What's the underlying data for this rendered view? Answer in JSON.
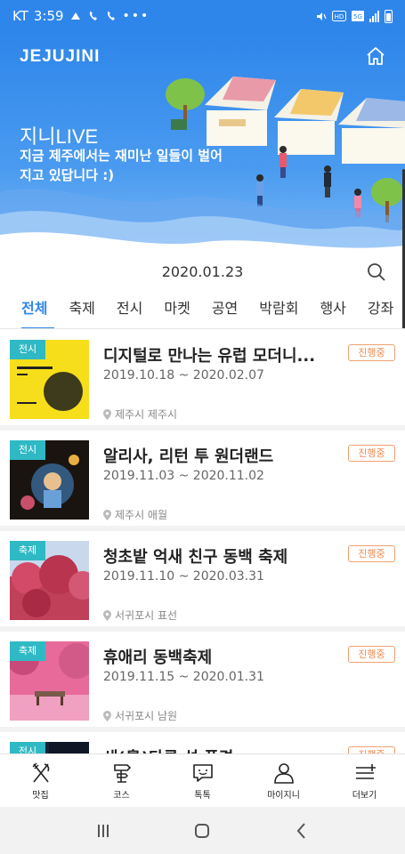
{
  "status_bar": {
    "carrier": "KT",
    "time": "3:59",
    "dots": "•••"
  },
  "header": {
    "logo": "JEJUJINI"
  },
  "banner": {
    "title": "지니LIVE",
    "subtitle": "지금 제주에서는 재미난 일들이 벌어지고 있답니다 :)"
  },
  "date": "2020.01.23",
  "tabs": [
    {
      "label": "전체"
    },
    {
      "label": "축제"
    },
    {
      "label": "전시"
    },
    {
      "label": "마켓"
    },
    {
      "label": "공연"
    },
    {
      "label": "박람회"
    },
    {
      "label": "행사"
    },
    {
      "label": "강좌"
    }
  ],
  "items": [
    {
      "category": "전시",
      "title": "디지털로 만나는 유럽 모더니...",
      "dates": "2019.10.18 ~ 2020.02.07",
      "location": "제주시 제주시",
      "status": "진행중"
    },
    {
      "category": "전시",
      "title": "알리사, 리턴 투 원더랜드",
      "dates": "2019.11.03 ~ 2020.11.02",
      "location": "제주시 애월",
      "status": "진행중"
    },
    {
      "category": "축제",
      "title": "청초밭 억새 친구 동백 축제",
      "dates": "2019.11.10 ~ 2020.03.31",
      "location": "서귀포시 표선",
      "status": "진행중"
    },
    {
      "category": "축제",
      "title": "휴애리 동백축제",
      "dates": "2019.11.15 ~ 2020.01.31",
      "location": "서귀포시 남원",
      "status": "진행중"
    },
    {
      "category": "전시",
      "title": "새(鳥)다른 섬 풍경",
      "dates": "",
      "location": "",
      "status": "진행중"
    }
  ],
  "bottom_nav": [
    {
      "label": "맛집",
      "icon": "fork-knife-icon"
    },
    {
      "label": "코스",
      "icon": "signpost-icon"
    },
    {
      "label": "톡톡",
      "icon": "chat-smile-icon"
    },
    {
      "label": "마이지니",
      "icon": "person-icon"
    },
    {
      "label": "더보기",
      "icon": "menu-plus-icon"
    }
  ],
  "colors": {
    "primary": "#2f86ea",
    "badge_teal": "#2fb9c4",
    "status_orange": "#ec8a4e"
  }
}
